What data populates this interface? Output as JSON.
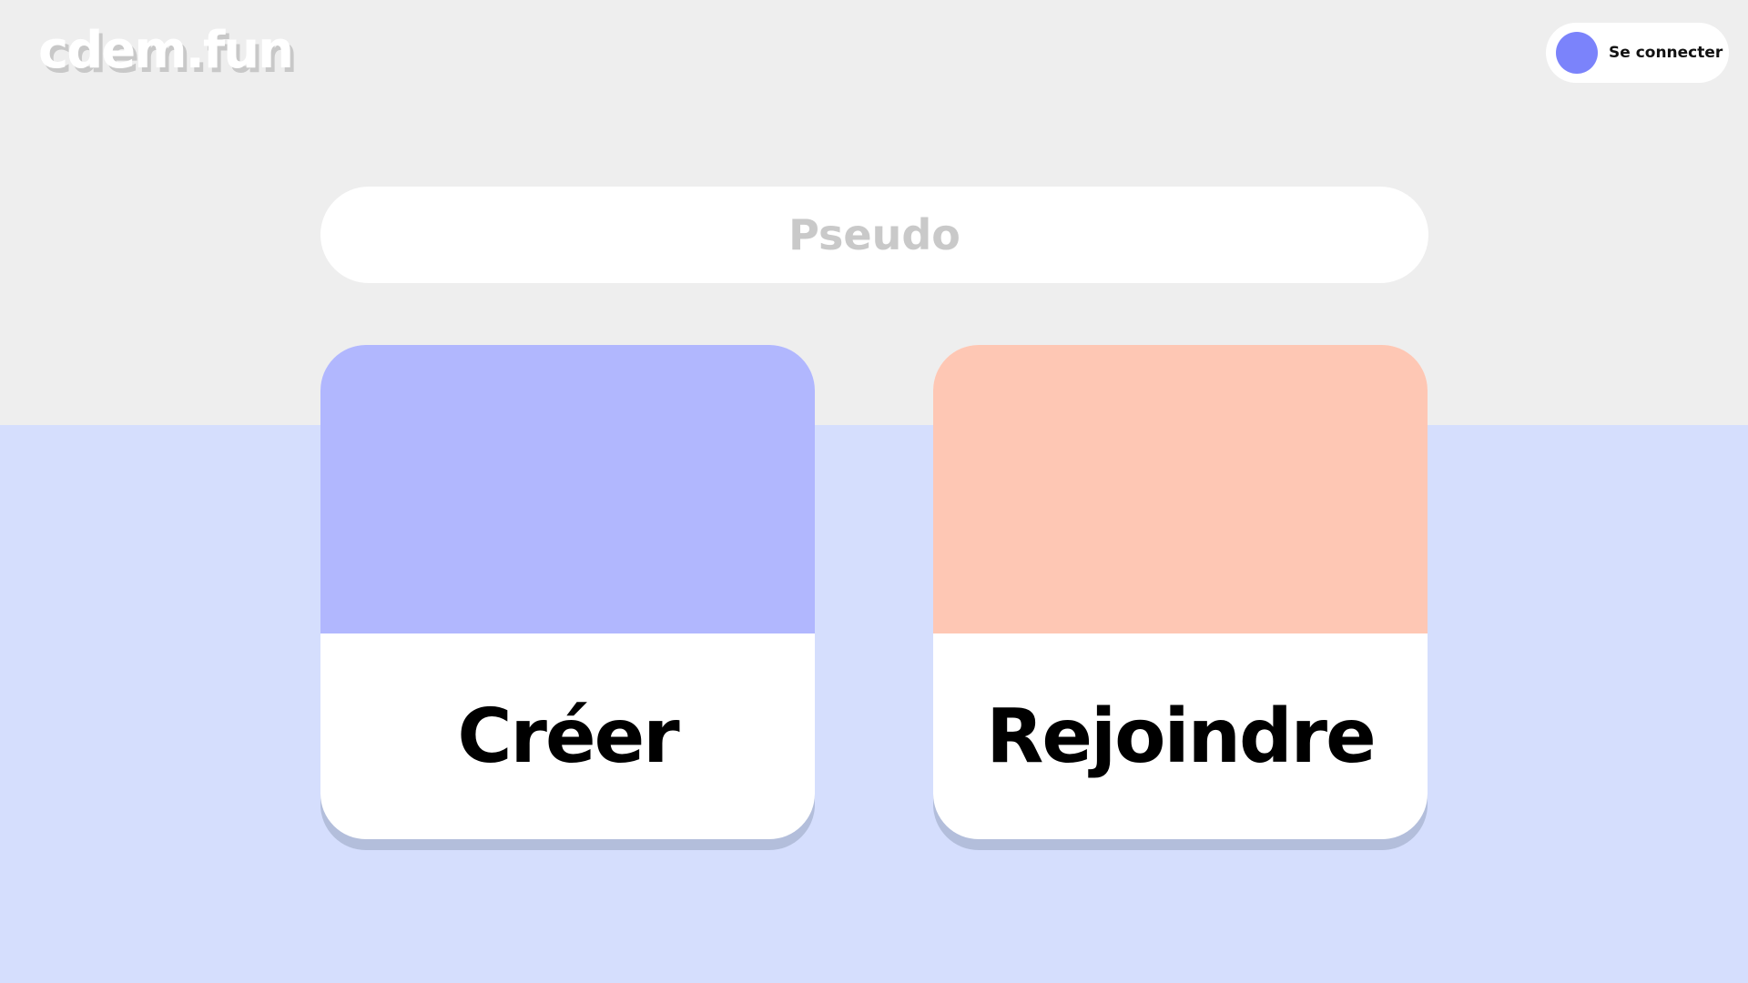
{
  "header": {
    "logo_text": "cdem.fun",
    "login_label": "Se connecter"
  },
  "pseudo": {
    "placeholder": "Pseudo",
    "value": ""
  },
  "actions": [
    {
      "label": "Créer",
      "color": "#b1b7fe"
    },
    {
      "label": "Rejoindre",
      "color": "#fec7b4"
    }
  ],
  "colors": {
    "page_background": "#eeeeee",
    "bottom_band": "#d5defd",
    "avatar": "#7b83fb"
  }
}
